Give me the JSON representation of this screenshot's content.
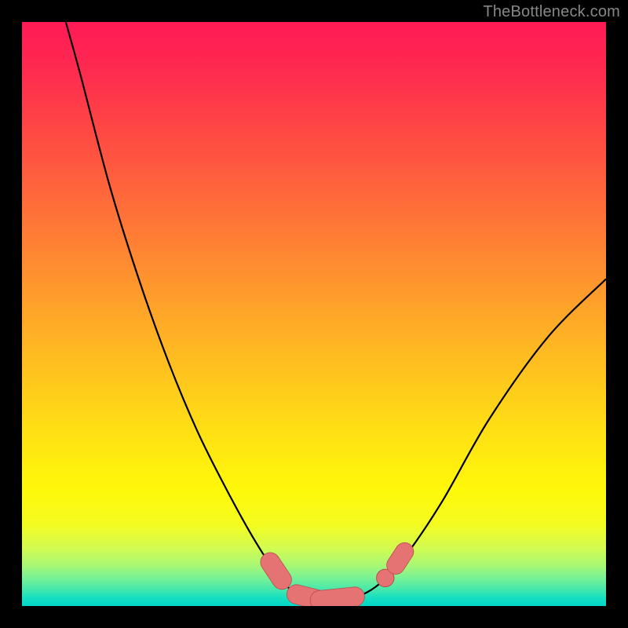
{
  "watermark": "TheBottleneck.com",
  "palette": {
    "frame": "#000000",
    "curve": "#000000",
    "marker_fill": "#e57373",
    "marker_stroke": "#b84c4c"
  },
  "chart_data": {
    "type": "line",
    "title": "",
    "xlabel": "",
    "ylabel": "",
    "xlim": [
      0,
      100
    ],
    "ylim": [
      0,
      100
    ],
    "grid": false,
    "legend": false,
    "note": "Values in percent of plot-area; y=0 is the bottom edge, y=100 the top edge.",
    "curve_points": [
      {
        "x": 7.5,
        "y": 100.0
      },
      {
        "x": 10.0,
        "y": 91.0
      },
      {
        "x": 15.0,
        "y": 72.0
      },
      {
        "x": 20.0,
        "y": 56.0
      },
      {
        "x": 25.0,
        "y": 42.0
      },
      {
        "x": 30.0,
        "y": 30.0
      },
      {
        "x": 35.0,
        "y": 20.0
      },
      {
        "x": 40.0,
        "y": 11.0
      },
      {
        "x": 44.0,
        "y": 5.0
      },
      {
        "x": 47.0,
        "y": 2.0
      },
      {
        "x": 50.0,
        "y": 1.0
      },
      {
        "x": 53.0,
        "y": 1.0
      },
      {
        "x": 56.0,
        "y": 1.3
      },
      {
        "x": 59.0,
        "y": 2.3
      },
      {
        "x": 62.0,
        "y": 4.5
      },
      {
        "x": 66.0,
        "y": 9.0
      },
      {
        "x": 72.0,
        "y": 18.0
      },
      {
        "x": 80.0,
        "y": 32.0
      },
      {
        "x": 90.0,
        "y": 46.0
      },
      {
        "x": 100.0,
        "y": 56.0
      }
    ],
    "markers": [
      {
        "shape": "capsule",
        "x1": 42.5,
        "y1": 7.5,
        "x2": 44.5,
        "y2": 4.5,
        "r": 1.6
      },
      {
        "shape": "capsule",
        "x1": 47.0,
        "y1": 2.0,
        "x2": 51.0,
        "y2": 1.0,
        "r": 1.6
      },
      {
        "shape": "capsule",
        "x1": 51.0,
        "y1": 1.0,
        "x2": 57.0,
        "y2": 1.6,
        "r": 1.6
      },
      {
        "shape": "dot",
        "cx": 62.2,
        "cy": 4.8,
        "r": 1.5
      },
      {
        "shape": "capsule",
        "x1": 64.0,
        "y1": 7.0,
        "x2": 65.5,
        "y2": 9.3,
        "r": 1.5
      }
    ],
    "gradient_stops": [
      {
        "pos": 0.0,
        "color": "#ff1a56"
      },
      {
        "pos": 0.08,
        "color": "#ff2a50"
      },
      {
        "pos": 0.16,
        "color": "#ff4046"
      },
      {
        "pos": 0.24,
        "color": "#ff5740"
      },
      {
        "pos": 0.32,
        "color": "#ff6f39"
      },
      {
        "pos": 0.4,
        "color": "#ff8732"
      },
      {
        "pos": 0.48,
        "color": "#ffa02a"
      },
      {
        "pos": 0.56,
        "color": "#ffb822"
      },
      {
        "pos": 0.64,
        "color": "#ffcf1a"
      },
      {
        "pos": 0.72,
        "color": "#ffe512"
      },
      {
        "pos": 0.8,
        "color": "#fff80a"
      },
      {
        "pos": 0.86,
        "color": "#f4fc20"
      },
      {
        "pos": 0.9,
        "color": "#d4fb50"
      },
      {
        "pos": 0.93,
        "color": "#a8f874"
      },
      {
        "pos": 0.95,
        "color": "#7cf292"
      },
      {
        "pos": 0.97,
        "color": "#4ae9aa"
      },
      {
        "pos": 0.985,
        "color": "#18e0c0"
      },
      {
        "pos": 1.0,
        "color": "#00d7c8"
      }
    ]
  }
}
